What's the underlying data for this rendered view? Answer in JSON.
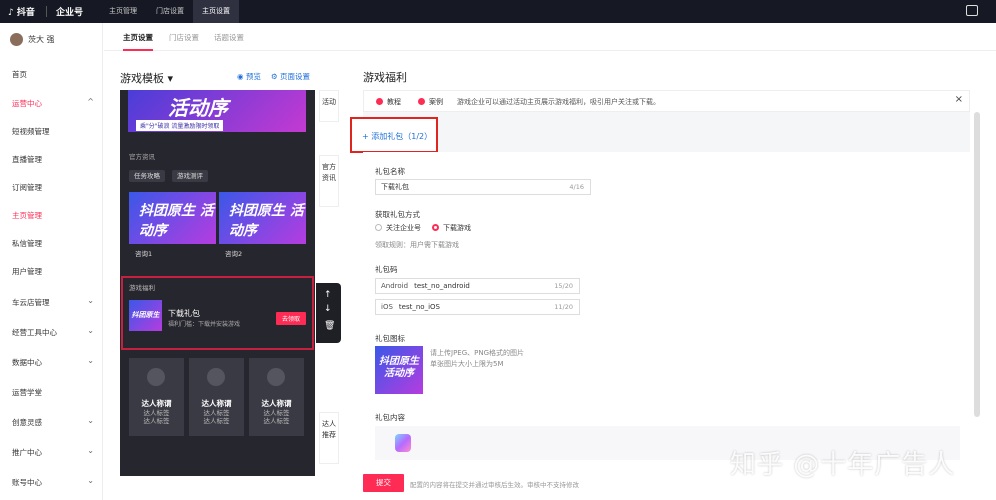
{
  "topbar": {
    "logo": "♪ 抖音",
    "brand": "企业号",
    "nav": [
      "主页管理",
      "门店设置",
      "主页设置"
    ]
  },
  "sidebar": {
    "username": "茨大 强",
    "items": [
      {
        "label": "首页",
        "chev": ""
      },
      {
        "label": "运营中心",
        "chev": "^"
      },
      {
        "label": "短视频管理",
        "chev": ""
      },
      {
        "label": "直播管理",
        "chev": ""
      },
      {
        "label": "订阅管理",
        "chev": ""
      },
      {
        "label": "主页管理",
        "chev": ""
      },
      {
        "label": "私信管理",
        "chev": ""
      },
      {
        "label": "用户管理",
        "chev": ""
      },
      {
        "label": "车云店管理",
        "chev": "⌄"
      },
      {
        "label": "经营工具中心",
        "chev": "⌄"
      },
      {
        "label": "数据中心",
        "chev": "⌄"
      },
      {
        "label": "运营学堂",
        "chev": ""
      },
      {
        "label": "创意灵感",
        "chev": "⌄"
      },
      {
        "label": "推广中心",
        "chev": "⌄"
      },
      {
        "label": "账号中心",
        "chev": "⌄"
      }
    ]
  },
  "tabs": [
    "主页设置",
    "门店设置",
    "话题设置"
  ],
  "template": {
    "title": "游戏模板 ▾",
    "preview": "预览",
    "page_settings": "页面设置",
    "banner_text": "活动序",
    "banner_sub": "乘\"分\"破浪 流量激励限时领取",
    "news_label": "官方资讯",
    "chip1": "任务攻略",
    "chip2": "游戏测评",
    "news_img": "抖团原生 活动序",
    "news1": "咨询1",
    "news2": "咨询2",
    "welfare_label": "游戏福利",
    "welfare_thumb": "抖团原生",
    "welfare_name": "下载礼包",
    "welfare_desc": "福利门槛：下载并安装游戏",
    "welfare_btn": "去领取",
    "talent_name": "达人称谓",
    "talent_tag1": "达人标签",
    "talent_tag2": "达人标签",
    "vtab_activity": "活动",
    "vtab_news": "官方资讯",
    "vtab_talent": "达人推荐"
  },
  "gift": {
    "title": "游戏福利",
    "tutorial": "教程",
    "case": "案例",
    "notice": "游戏企业可以通过活动主页展示游戏福利，吸引用户关注或下载。",
    "add_btn": "+ 添加礼包（1/2）",
    "name_label": "礼包名称",
    "name_value": "下载礼包",
    "name_count": "4/16",
    "method_label": "获取礼包方式",
    "method_opt1": "关注企业号",
    "method_opt2": "下载游戏",
    "rule": "领取规则：用户需下载游戏",
    "code_label": "礼包码",
    "android_pre": "Android",
    "android_val": "test_no_android",
    "android_count": "15/20",
    "ios_pre": "iOS",
    "ios_val": "test_no_iOS",
    "ios_count": "11/20",
    "icon_label": "礼包图标",
    "icon_img": "抖团原生 活动序",
    "icon_hint1": "请上传JPEG、PNG格式的图片",
    "icon_hint2": "单张图片大小上限为5M",
    "content_label": "礼包内容",
    "submit": "提交",
    "foot_note": "配置的内容将在提交并通过审核后生效。审核中不支持修改"
  },
  "watermark": "知乎 @十年广告人"
}
